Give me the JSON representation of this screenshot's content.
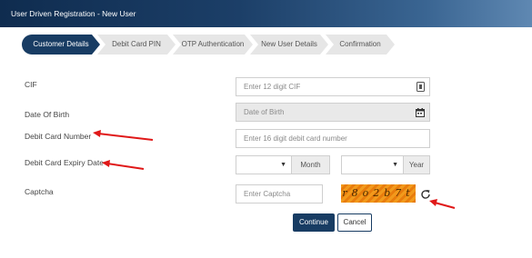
{
  "window": {
    "title": "User Driven Registration - New User"
  },
  "steps": [
    {
      "label": "Customer Details",
      "active": true
    },
    {
      "label": "Debit Card PIN",
      "active": false
    },
    {
      "label": "OTP Authentication",
      "active": false
    },
    {
      "label": "New User Details",
      "active": false
    },
    {
      "label": "Confirmation",
      "active": false
    }
  ],
  "form": {
    "cif": {
      "label": "CIF",
      "placeholder": "Enter 12 digit CIF"
    },
    "dob": {
      "label": "Date Of Birth",
      "placeholder": "Date of Birth"
    },
    "card_number": {
      "label": "Debit Card Number",
      "placeholder": "Enter 16 digit debit card number"
    },
    "expiry": {
      "label": "Debit Card Expiry Date",
      "month_addon": "Month",
      "year_addon": "Year"
    },
    "captcha": {
      "label": "Captcha",
      "placeholder": "Enter Captcha",
      "image_text": "r8o2b7t"
    }
  },
  "buttons": {
    "continue": "Continue",
    "cancel": "Cancel"
  },
  "icons": {
    "cif": "card-icon",
    "dob": "calendar-icon",
    "captcha_refresh": "refresh-icon",
    "annotation": "red-arrow-icon"
  },
  "colors": {
    "primary": "#183c63",
    "annotation": "#e01818",
    "captcha_bg": "#f29a1c"
  }
}
